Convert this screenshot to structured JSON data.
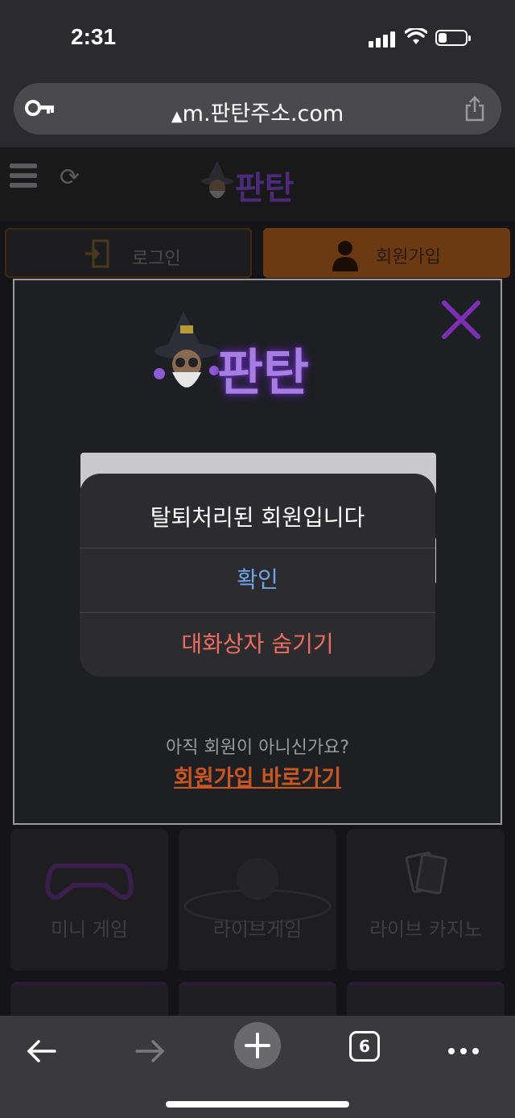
{
  "status": {
    "time": "2:31",
    "battery_level": 0.3
  },
  "browser": {
    "url": "m.판탄주소.com",
    "tab_count": "6"
  },
  "site": {
    "logo": "판탄",
    "tabs": {
      "login": "로그인",
      "join": "회원가입"
    },
    "cards": [
      "미니 게임",
      "라이브게임",
      "라이브 카지노"
    ]
  },
  "modal": {
    "logo": "판탄",
    "input_placeholder": "",
    "signup_prompt": "아직 회원이 아니신가요?",
    "signup_link": "회원가입 바로가기"
  },
  "alert": {
    "message": "탈퇴처리된 회원입니다",
    "confirm": "확인",
    "hide": "대화상자 숨기기"
  },
  "colors": {
    "accent_orange": "#c9571f",
    "confirm_blue": "#6ea6ee",
    "hide_red": "#ee6c62",
    "logo_purple": "#a67de0"
  }
}
